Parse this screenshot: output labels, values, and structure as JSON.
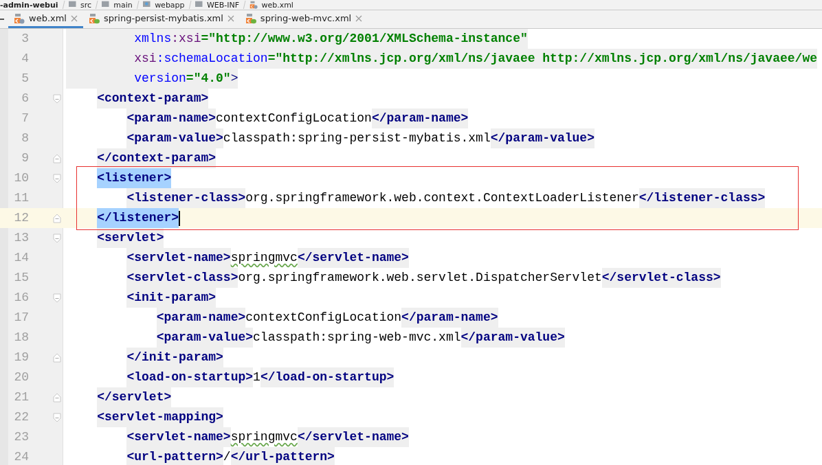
{
  "breadcrumb": [
    {
      "label": "-admin-webui",
      "kind": "module"
    },
    {
      "label": "src",
      "kind": "folder"
    },
    {
      "label": "main",
      "kind": "folder"
    },
    {
      "label": "webapp",
      "kind": "web"
    },
    {
      "label": "WEB-INF",
      "kind": "folder"
    },
    {
      "label": "web.xml",
      "kind": "file"
    }
  ],
  "tabs": [
    {
      "label": "web.xml",
      "selected": true,
      "kind": "web"
    },
    {
      "label": "spring-persist-mybatis.xml",
      "selected": false,
      "kind": "spring"
    },
    {
      "label": "spring-web-mvc.xml",
      "selected": false,
      "kind": "spring"
    }
  ],
  "lines": [
    {
      "number": "3",
      "kind": "attribute",
      "current": false,
      "caret": false,
      "fold_start": false,
      "fold_end": false,
      "tokens": [
        {
          "kind": "name",
          "text": "xmlns"
        },
        {
          "kind": "prefix",
          "text": ":xsi"
        },
        {
          "kind": "value",
          "text": "=\"http://www.w3.org/2001/XMLSchema-instance\""
        }
      ]
    },
    {
      "number": "4",
      "kind": "attribute",
      "current": false,
      "caret": false,
      "fold_start": false,
      "fold_end": false,
      "tokens": [
        {
          "kind": "prefix",
          "text": "xsi"
        },
        {
          "kind": "name",
          "text": ":schemaLocation"
        },
        {
          "kind": "value",
          "text": "=\"http://xmlns.jcp.org/xml/ns/javaee http://xmlns.jcp.org/xml/ns/javaee/we"
        }
      ]
    },
    {
      "number": "5",
      "kind": "attribute",
      "current": false,
      "caret": false,
      "fold_start": false,
      "fold_end": false,
      "tokens": [
        {
          "kind": "name",
          "text": "version"
        },
        {
          "kind": "value",
          "text": "=\"4.0\""
        },
        {
          "kind": "bracket",
          "text": ">"
        }
      ]
    },
    {
      "number": "6",
      "kind": "element",
      "current": false,
      "caret": false,
      "fold_start": true,
      "fold_end": false,
      "tokens": [
        {
          "kind": "tag",
          "text": "<context-param>"
        }
      ]
    },
    {
      "number": "7",
      "kind": "element",
      "current": false,
      "caret": false,
      "fold_start": false,
      "fold_end": false,
      "tokens": [
        {
          "kind": "tag",
          "text": "<param-name>"
        },
        {
          "kind": "text",
          "text": "contextConfigLocation"
        },
        {
          "kind": "tag",
          "text": "</param-name>"
        }
      ]
    },
    {
      "number": "8",
      "kind": "element",
      "current": false,
      "caret": false,
      "fold_start": false,
      "fold_end": false,
      "tokens": [
        {
          "kind": "tag",
          "text": "<param-value>"
        },
        {
          "kind": "text",
          "text": "classpath:spring-persist-mybatis.xml"
        },
        {
          "kind": "tag",
          "text": "</param-value>"
        }
      ]
    },
    {
      "number": "9",
      "kind": "element",
      "current": false,
      "caret": false,
      "fold_start": false,
      "fold_end": true,
      "tokens": [
        {
          "kind": "tag",
          "text": "</context-param>"
        }
      ]
    },
    {
      "kind": "box",
      "color": "#e8302f",
      "lines": [
        {
          "number": "10",
          "kind": "element",
          "current": false,
          "caret": false,
          "fold_start": true,
          "fold_end": false,
          "tokens": [
            {
              "kind": "tag",
              "text": "<listener>",
              "matched": true
            }
          ]
        },
        {
          "number": "11",
          "kind": "element",
          "current": false,
          "caret": false,
          "fold_start": false,
          "fold_end": false,
          "tokens": [
            {
              "kind": "tag",
              "text": "<listener-class>"
            },
            {
              "kind": "text",
              "text": "org.springframework.web.context.ContextLoaderListener"
            },
            {
              "kind": "tag",
              "text": "</listener-class>"
            }
          ]
        },
        {
          "number": "12",
          "kind": "element",
          "current": true,
          "caret": true,
          "fold_start": false,
          "fold_end": true,
          "tokens": [
            {
              "kind": "tag",
              "text": "</listener>",
              "matched": true
            }
          ]
        }
      ]
    },
    {
      "number": "13",
      "kind": "element",
      "current": false,
      "caret": false,
      "fold_start": true,
      "fold_end": false,
      "tokens": [
        {
          "kind": "tag",
          "text": "<servlet>"
        }
      ]
    },
    {
      "number": "14",
      "kind": "element",
      "current": false,
      "caret": false,
      "fold_start": false,
      "fold_end": false,
      "tokens": [
        {
          "kind": "tag",
          "text": "<servlet-name>"
        },
        {
          "kind": "text",
          "text": "springmvc",
          "typo": true
        },
        {
          "kind": "tag",
          "text": "</servlet-name>"
        }
      ]
    },
    {
      "number": "15",
      "kind": "element",
      "current": false,
      "caret": false,
      "fold_start": false,
      "fold_end": false,
      "tokens": [
        {
          "kind": "tag",
          "text": "<servlet-class>"
        },
        {
          "kind": "text",
          "text": "org.springframework.web.servlet.DispatcherServlet"
        },
        {
          "kind": "tag",
          "text": "</servlet-class>"
        }
      ]
    },
    {
      "number": "16",
      "kind": "element",
      "current": false,
      "caret": false,
      "fold_start": true,
      "fold_end": false,
      "tokens": [
        {
          "kind": "tag",
          "text": "<init-param>"
        }
      ]
    },
    {
      "number": "17",
      "kind": "element",
      "current": false,
      "caret": false,
      "fold_start": false,
      "fold_end": false,
      "tokens": [
        {
          "kind": "tag",
          "text": "<param-name>"
        },
        {
          "kind": "text",
          "text": "contextConfigLocation"
        },
        {
          "kind": "tag",
          "text": "</param-name>"
        }
      ]
    },
    {
      "number": "18",
      "kind": "element",
      "current": false,
      "caret": false,
      "fold_start": false,
      "fold_end": false,
      "tokens": [
        {
          "kind": "tag",
          "text": "<param-value>"
        },
        {
          "kind": "text",
          "text": "classpath:spring-web-mvc.xml"
        },
        {
          "kind": "tag",
          "text": "</param-value>"
        }
      ]
    },
    {
      "number": "19",
      "kind": "element",
      "current": false,
      "caret": false,
      "fold_start": false,
      "fold_end": true,
      "tokens": [
        {
          "kind": "tag",
          "text": "</init-param>"
        }
      ]
    },
    {
      "number": "20",
      "kind": "element",
      "current": false,
      "caret": false,
      "fold_start": false,
      "fold_end": false,
      "tokens": [
        {
          "kind": "tag",
          "text": "<load-on-startup>"
        },
        {
          "kind": "text",
          "text": "1"
        },
        {
          "kind": "tag",
          "text": "</load-on-startup>"
        }
      ]
    },
    {
      "number": "21",
      "kind": "element",
      "current": false,
      "caret": false,
      "fold_start": false,
      "fold_end": true,
      "tokens": [
        {
          "kind": "tag",
          "text": "</servlet>"
        }
      ]
    },
    {
      "number": "22",
      "kind": "element",
      "current": false,
      "caret": false,
      "fold_start": true,
      "fold_end": false,
      "tokens": [
        {
          "kind": "tag",
          "text": "<servlet-mapping>"
        }
      ]
    },
    {
      "number": "23",
      "kind": "element",
      "current": false,
      "caret": false,
      "fold_start": false,
      "fold_end": false,
      "tokens": [
        {
          "kind": "tag",
          "text": "<servlet-name>"
        },
        {
          "kind": "text",
          "text": "springmvc",
          "typo": true
        },
        {
          "kind": "tag",
          "text": "</servlet-name>"
        }
      ]
    },
    {
      "number": "24",
      "kind": "element",
      "current": false,
      "caret": false,
      "fold_start": false,
      "fold_end": false,
      "tokens": [
        {
          "kind": "tag",
          "text": "<url-pattern>"
        },
        {
          "kind": "text",
          "text": "/"
        },
        {
          "kind": "tag",
          "text": "</url-pattern>"
        }
      ]
    }
  ]
}
